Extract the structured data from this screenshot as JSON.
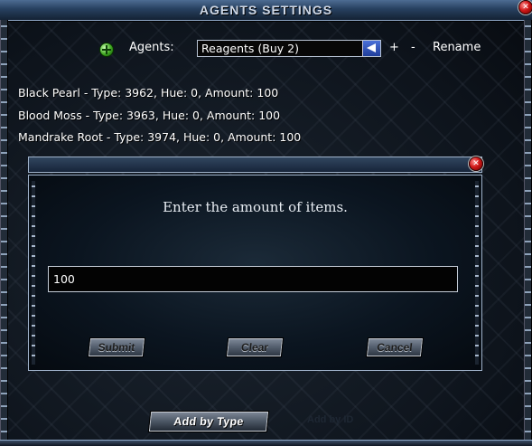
{
  "window": {
    "title": "AGENTS SETTINGS",
    "close_symbol": "✕"
  },
  "agents": {
    "label": "Agents:",
    "selected": "Reagents (Buy 2)",
    "add_label": "+",
    "remove_label": "-",
    "rename_label": "Rename"
  },
  "items": [
    "Black Pearl - Type: 3962, Hue: 0, Amount: 100",
    "Blood Moss - Type: 3963, Hue: 0, Amount: 100",
    "Mandrake Root - Type: 3974, Hue: 0, Amount: 100"
  ],
  "dialog": {
    "prompt": "Enter the amount of items.",
    "input_value": "100",
    "submit_label": "Submit",
    "clear_label": "Clear",
    "cancel_label": "Cancel",
    "close_symbol": "✕"
  },
  "footer": {
    "add_by_type_label": "Add by Type",
    "ghost_label": "Add by ID"
  },
  "colors": {
    "title_bar": "#27405f",
    "border": "#9fb2ca",
    "close_red": "#d01818",
    "add_green": "#3ea520",
    "dropdown_arrow_blue": "#1f3d9b"
  }
}
